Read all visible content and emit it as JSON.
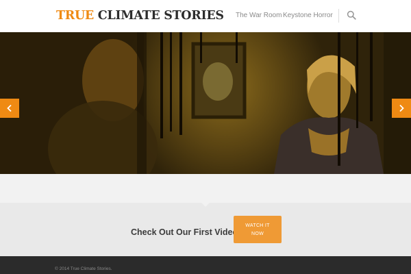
{
  "header": {
    "logo_accent": "TRUE",
    "logo_rest": "CLIMATE STORIES",
    "nav": [
      {
        "label": "The War Room"
      },
      {
        "label": "Keystone Horror"
      }
    ],
    "search_icon": "search-icon"
  },
  "hero": {
    "prev_icon": "chevron-left-icon",
    "next_icon": "chevron-right-icon"
  },
  "cta": {
    "text": "Check Out Our First Video!",
    "button_line1": "WATCH IT",
    "button_line2": "NOW"
  },
  "footer": {
    "copyright": "© 2014 True Climate Stories."
  },
  "colors": {
    "accent": "#ef8a13",
    "button": "#ef9a35",
    "footer_bg": "#2b2b2b"
  }
}
